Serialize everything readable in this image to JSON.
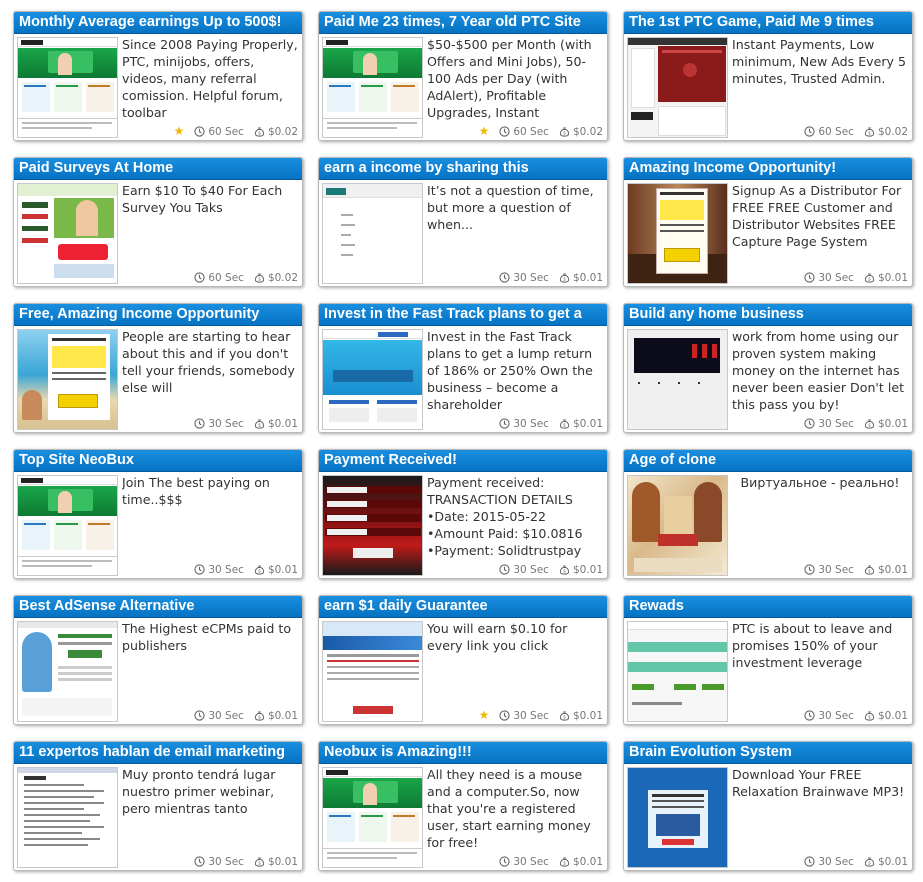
{
  "ads": [
    {
      "title": "Monthly Average earnings Up to 500$!",
      "desc": "Since 2008 Paying Properly, PTC, minijobs, offers, videos, many referral comission. Helpful forum, toolbar",
      "duration": "60 Sec",
      "reward": "$0.02",
      "starred": true,
      "thumb": "neobux"
    },
    {
      "title": "Paid Me 23 times, 7 Year old PTC Site",
      "desc": "$50-$500 per Month (with Offers and Mini Jobs), 50-100 Ads per Day (with AdAlert), Profitable Upgrades, Instant",
      "duration": "60 Sec",
      "reward": "$0.02",
      "starred": true,
      "thumb": "neobux"
    },
    {
      "title": "The 1st PTC Game, Paid Me 9 times",
      "desc": "Instant Payments, Low minimum, New Ads Every 5 minutes, Trusted Admin.",
      "duration": "60 Sec",
      "reward": "$0.02",
      "starred": false,
      "thumb": "game"
    },
    {
      "title": "Paid Surveys At Home",
      "desc": "Earn $10 To $40 For Each Survey You Taks",
      "duration": "60 Sec",
      "reward": "$0.02",
      "starred": false,
      "thumb": "surveys"
    },
    {
      "title": "earn a income by sharing this",
      "desc": "It’s not a question of time, but more a question of when...",
      "duration": "30 Sec",
      "reward": "$0.01",
      "starred": false,
      "thumb": "blank"
    },
    {
      "title": "Amazing Income Opportunity!",
      "desc": "Signup As a Distributor For FREE FREE Customer and Distributor Websites FREE Capture Page System",
      "duration": "30 Sec",
      "reward": "$0.01",
      "starred": false,
      "thumb": "room"
    },
    {
      "title": "Free, Amazing Income Opportunity",
      "desc": "People are starting to hear about this and if you don't tell your friends, somebody else will",
      "duration": "30 Sec",
      "reward": "$0.01",
      "starred": false,
      "thumb": "beach"
    },
    {
      "title": "Invest in the Fast Track plans to get a",
      "desc": "Invest in the Fast Track plans to get a lump return of 186% or 250% Own the business – become a shareholder",
      "duration": "30 Sec",
      "reward": "$0.01",
      "starred": false,
      "thumb": "fasttrack"
    },
    {
      "title": "Build any home business",
      "desc": "work from home using our proven system making money on the internet has never been easier Don't let this pass you by!",
      "duration": "30 Sec",
      "reward": "$0.01",
      "starred": false,
      "thumb": "dark"
    },
    {
      "title": "Top Site NeoBux",
      "desc": "Join The best paying on time..$$$",
      "duration": "30 Sec",
      "reward": "$0.01",
      "starred": false,
      "thumb": "neobux"
    },
    {
      "title": "Payment Received!",
      "desc": "Payment received: TRANSACTION DETAILS •Date: 2015-05-22 •Amount Paid: $10.0816 •Payment: Solidtrustpay",
      "duration": "30 Sec",
      "reward": "$0.01",
      "starred": false,
      "thumb": "paradise"
    },
    {
      "title": "Age of clone",
      "desc": "Виртуальное - реально!",
      "duration": "30 Sec",
      "reward": "$0.01",
      "starred": false,
      "thumb": "clone",
      "center": true
    },
    {
      "title": "Best AdSense Alternative",
      "desc": "The Highest eCPMs paid to publishers",
      "duration": "30 Sec",
      "reward": "$0.01",
      "starred": false,
      "thumb": "adsense"
    },
    {
      "title": "earn $1 daily Guarantee",
      "desc": "You will earn $0.10 for every link you click",
      "duration": "30 Sec",
      "reward": "$0.01",
      "starred": true,
      "thumb": "daily"
    },
    {
      "title": "Rewads",
      "desc": "PTC is about to leave and promises 150% of your investment leverage",
      "duration": "30 Sec",
      "reward": "$0.01",
      "starred": false,
      "thumb": "rewads"
    },
    {
      "title": "11 expertos hablan de email marketing",
      "desc": "Muy pronto tendrá lugar nuestro primer webinar, pero mientras tanto",
      "duration": "30 Sec",
      "reward": "$0.01",
      "starred": false,
      "thumb": "doc"
    },
    {
      "title": "Neobux is Amazing!!!",
      "desc": "All they need is a mouse and a computer.So, now that you're a registered user, start earning money for free!",
      "duration": "30 Sec",
      "reward": "$0.01",
      "starred": false,
      "thumb": "neobux"
    },
    {
      "title": "Brain Evolution System",
      "desc": "Download Your FREE Relaxation Brainwave MP3!",
      "duration": "30 Sec",
      "reward": "$0.01",
      "starred": false,
      "thumb": "brain"
    }
  ],
  "colors": {
    "title_bar": "#0a7bd0",
    "title_text": "#ffffff",
    "desc_text": "#333333",
    "meta_text": "#777777",
    "star": "#f2b705"
  }
}
